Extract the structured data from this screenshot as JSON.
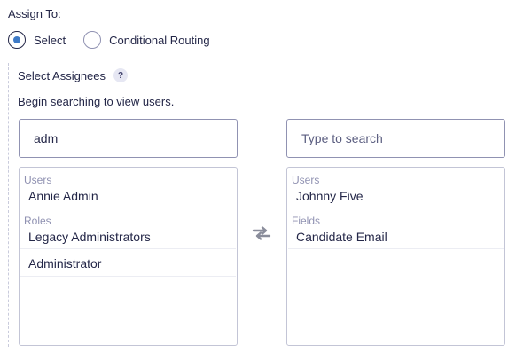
{
  "assign_to": {
    "label": "Assign To:",
    "options": [
      {
        "label": "Select",
        "selected": true
      },
      {
        "label": "Conditional Routing",
        "selected": false
      }
    ]
  },
  "assignees": {
    "title": "Select Assignees",
    "help_icon": "question-mark",
    "help_glyph": "?",
    "instructions": "Begin searching to view users.",
    "left": {
      "search_value": "adm",
      "search_placeholder": "",
      "groups": [
        {
          "label": "Users",
          "items": [
            "Annie Admin"
          ]
        },
        {
          "label": "Roles",
          "items": [
            "Legacy Administrators"
          ]
        },
        {
          "label": "",
          "items": [
            "Administrator"
          ]
        }
      ]
    },
    "swap_icon": "swap-arrows",
    "right": {
      "search_value": "",
      "search_placeholder": "Type to search",
      "groups": [
        {
          "label": "Users",
          "items": [
            "Johnny Five"
          ]
        },
        {
          "label": "Fields",
          "items": [
            "Candidate Email"
          ]
        }
      ]
    }
  },
  "colors": {
    "text": "#242748",
    "muted": "#9092b2",
    "accent": "#3e7ac6",
    "border": "#9092b2"
  }
}
